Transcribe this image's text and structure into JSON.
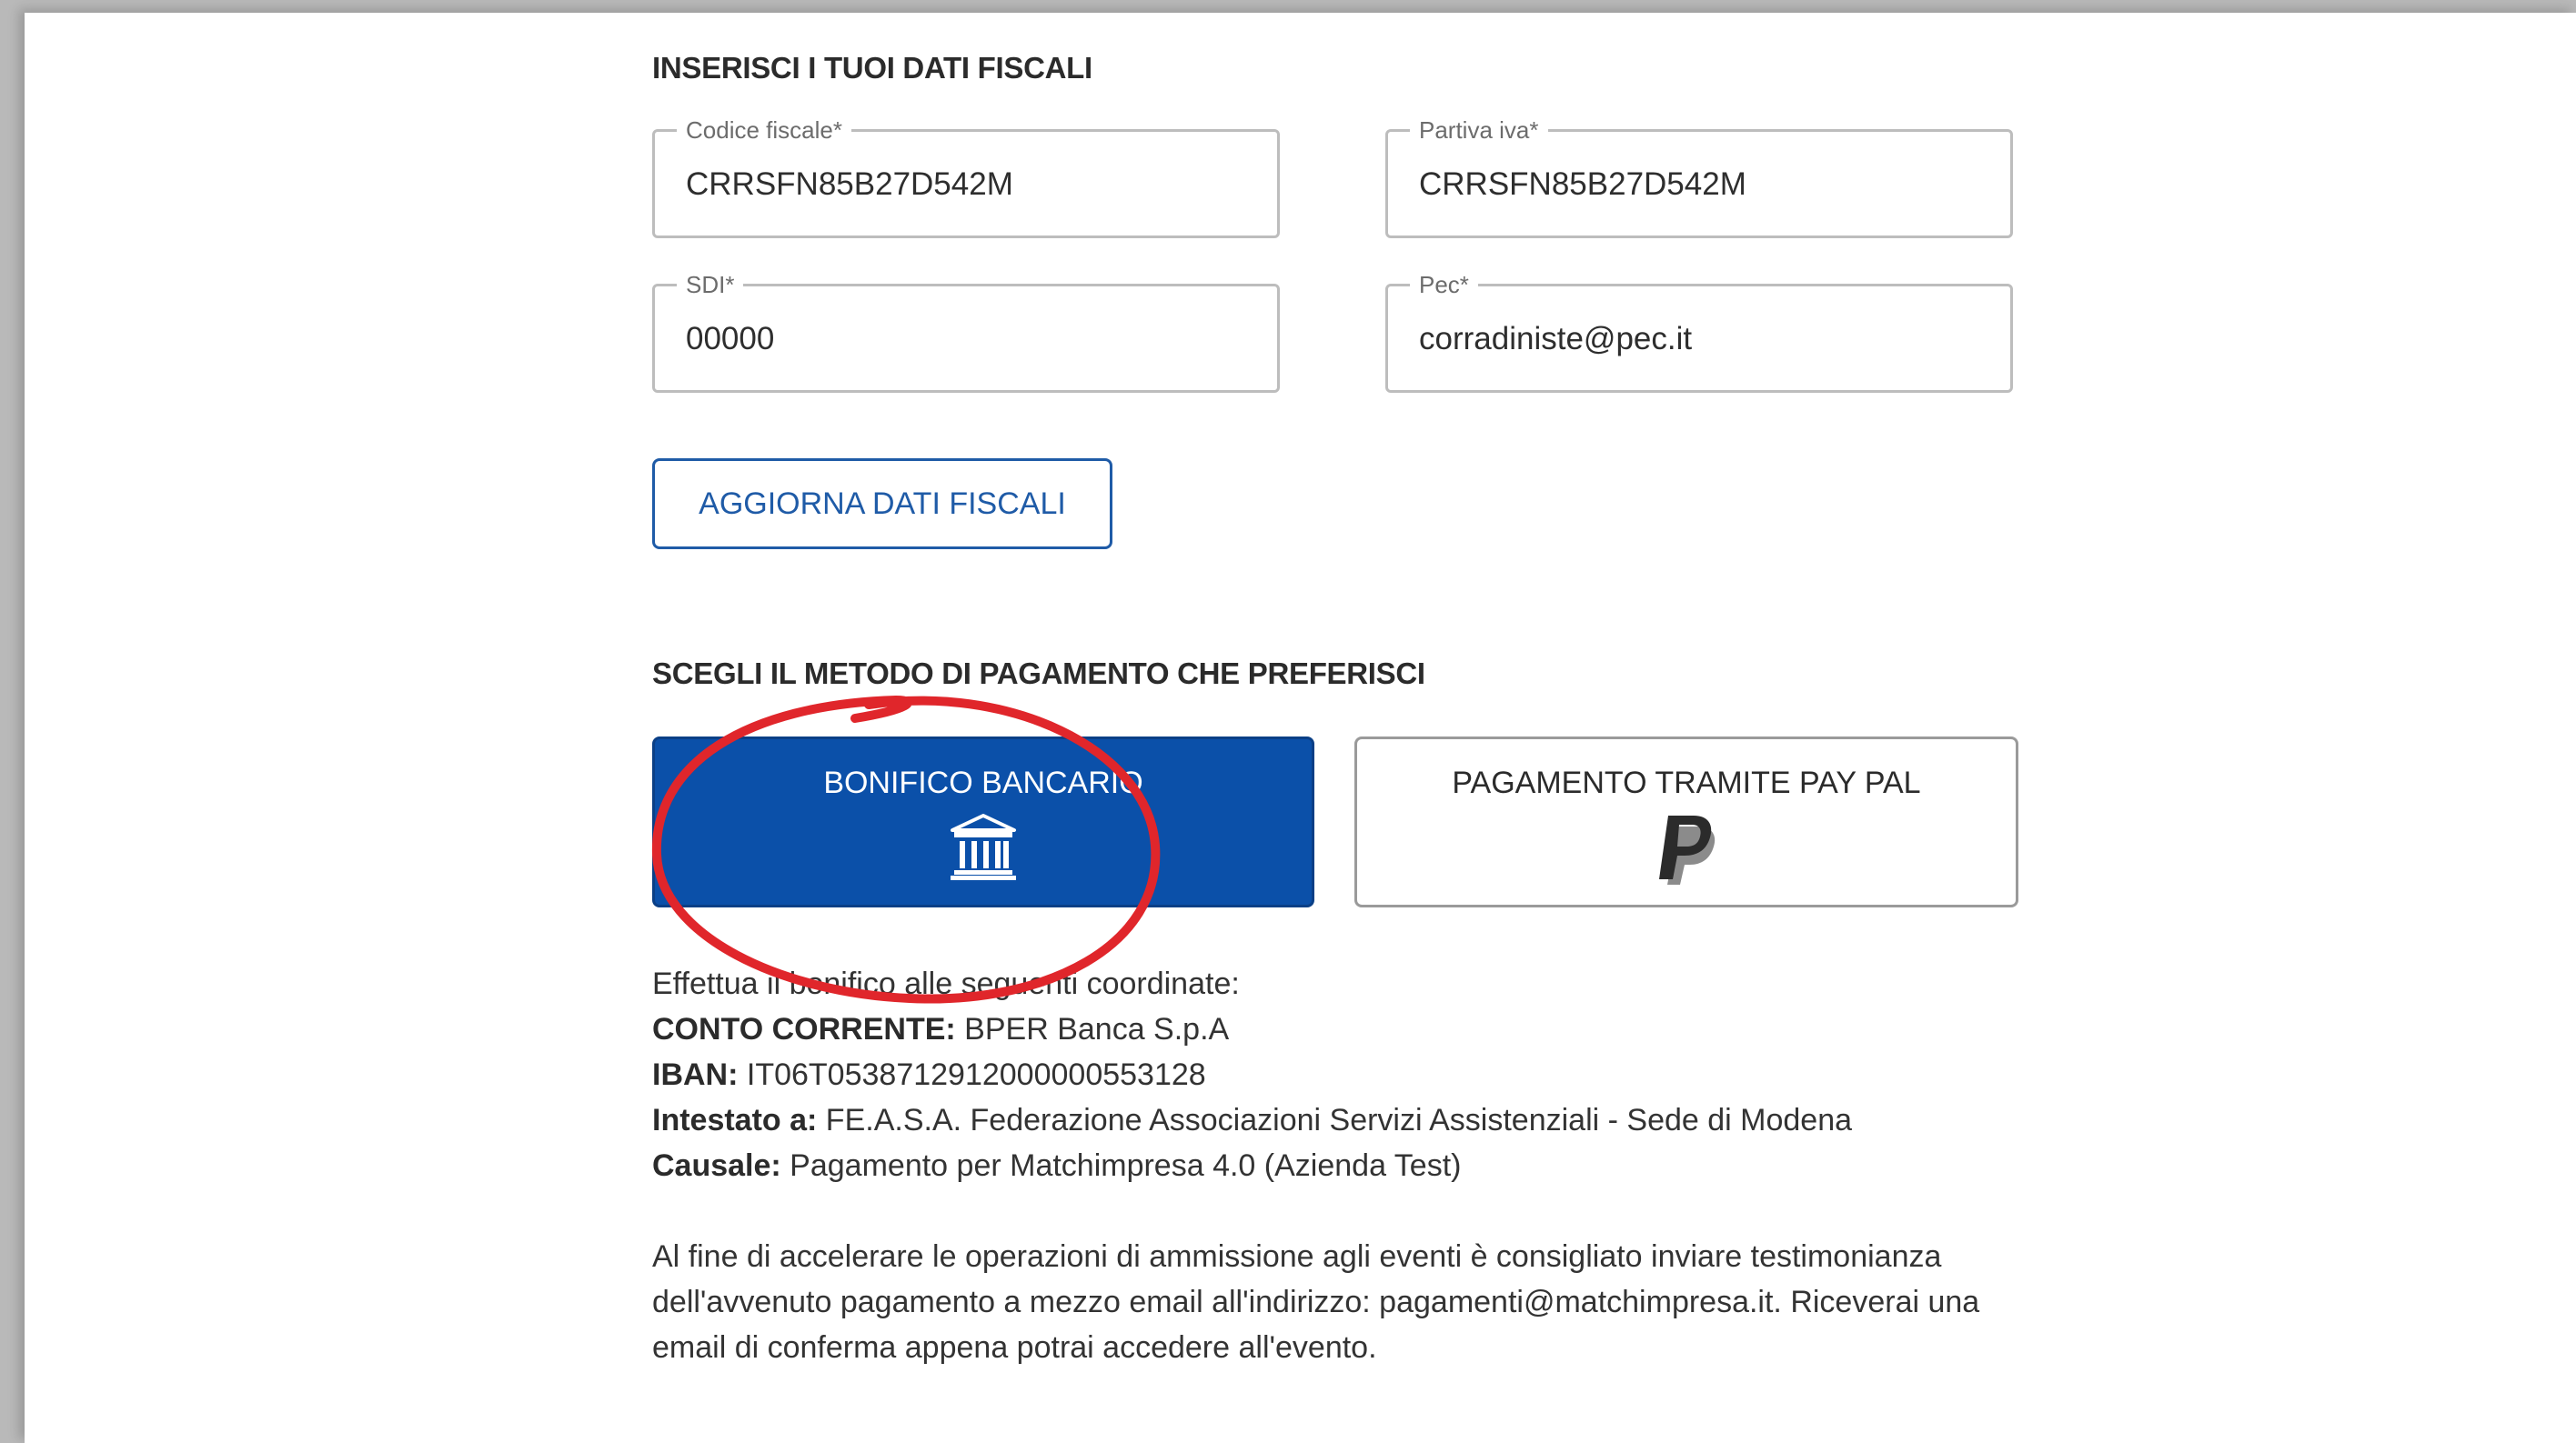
{
  "fiscal": {
    "title": "INSERISCI I TUOI DATI FISCALI",
    "fields": {
      "codice_fiscale": {
        "label": "Codice fiscale*",
        "value": "CRRSFN85B27D542M"
      },
      "partita_iva": {
        "label": "Partiva iva*",
        "value": "CRRSFN85B27D542M"
      },
      "sdi": {
        "label": "SDI*",
        "value": "00000"
      },
      "pec": {
        "label": "Pec*",
        "value": "corradiniste@pec.it"
      }
    },
    "update_button": "AGGIORNA DATI FISCALI"
  },
  "payment": {
    "title": "SCEGLI IL METODO DI PAGAMENTO CHE PREFERISCI",
    "options": {
      "bank": {
        "label": "BONIFICO BANCARIO",
        "icon": "bank-icon",
        "selected": true
      },
      "paypal": {
        "label": "PAGAMENTO TRAMITE PAY PAL",
        "icon": "paypal-icon",
        "selected": false
      }
    },
    "bank_details": {
      "intro": "Effettua il bonifico alle seguenti coordinate:",
      "conto_label": "CONTO CORRENTE:",
      "conto_value": " BPER Banca S.p.A",
      "iban_label": "IBAN:",
      "iban_value": " IT06T0538712912000000553128",
      "intestato_label": "Intestato a:",
      "intestato_value": " FE.A.S.A. Federazione Associazioni Servizi Assistenziali - Sede di Modena",
      "causale_label": "Causale:",
      "causale_value": " Pagamento per Matchimpresa 4.0 (Azienda Test)"
    },
    "note_line1": "Al fine di accelerare le operazioni di ammissione agli eventi è consigliato inviare testimonianza",
    "note_line2": "dell'avvenuto pagamento a mezzo email all'indirizzo: pagamenti@matchimpresa.it. Riceverai una",
    "note_line3": "email di conferma appena potrai accedere all'evento."
  },
  "colors": {
    "primary": "#0b50a9",
    "outline_button": "#1f5ba7",
    "annotation": "#e0262b"
  }
}
